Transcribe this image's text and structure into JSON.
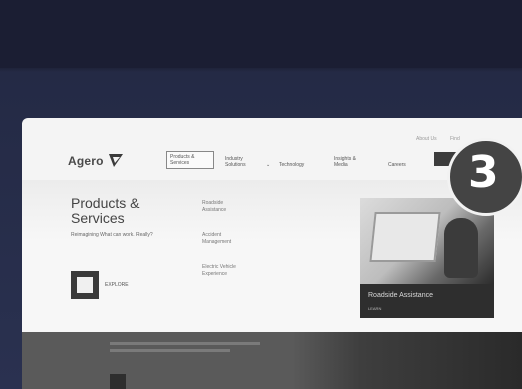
{
  "site": {
    "logo_text": "Agero",
    "utility_links": [
      "About Us",
      "Find"
    ],
    "nav": [
      {
        "label": "Products & Services",
        "active": true
      },
      {
        "label": "Industry Solutions",
        "active": false
      },
      {
        "label": "Technology",
        "active": false
      },
      {
        "label": "Insights & Media",
        "active": false
      },
      {
        "label": "Careers",
        "active": false
      }
    ]
  },
  "mega_menu": {
    "title": "Products & Services",
    "description": "Reimagining What can work. Really?",
    "explore_label": "EXPLORE",
    "links": [
      "Roadside Assistance",
      "Accident Management",
      "Electric Vehicle Experience"
    ],
    "feature": {
      "label": "Roadside Assistance",
      "sub": "LEARN"
    }
  },
  "step_badge": "3",
  "colors": {
    "page_bg": "#242a45",
    "window_bg": "#f4f4f4",
    "badge_bg": "#444444"
  }
}
